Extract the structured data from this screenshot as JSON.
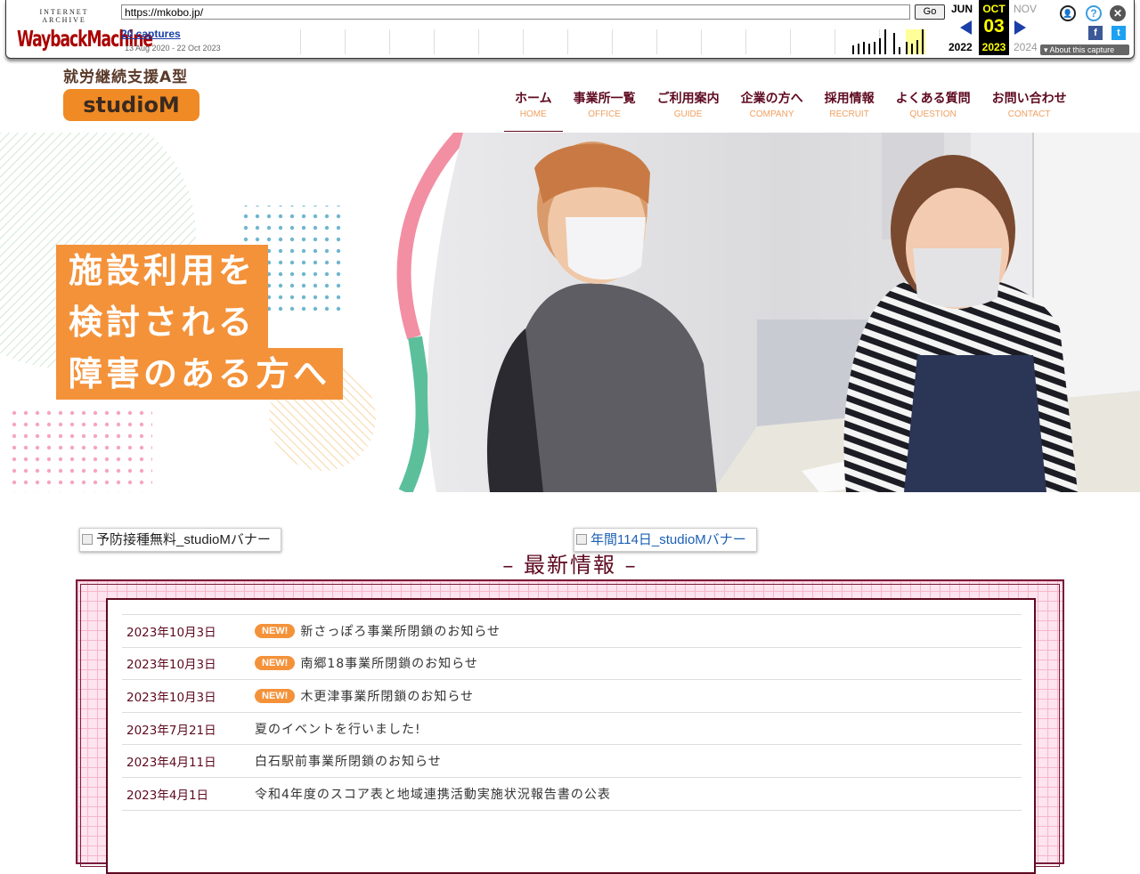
{
  "wayback": {
    "logo_top": "INTERNET ARCHIVE",
    "logo_main": "WaybackMachine",
    "url": "https://mkobo.jp/",
    "go_label": "Go",
    "captures_label": "20 captures",
    "date_range": "13 Aug 2020 - 22 Oct 2023",
    "prev_month": "JUN",
    "prev_year": "2022",
    "current_month": "OCT",
    "current_day": "03",
    "current_year": "2023",
    "next_month": "NOV",
    "next_year": "2024",
    "about_label": "About this capture",
    "facebook_glyph": "f",
    "twitter_glyph": "t",
    "help_glyph": "?",
    "close_glyph": "✕",
    "user_glyph": "👤"
  },
  "site": {
    "tagline": "就労継続支援A型",
    "brand": "studioM",
    "brand_color": "#f08a24",
    "accent_color": "#5e0a20"
  },
  "nav": {
    "items": [
      {
        "jp": "ホーム",
        "en": "HOME"
      },
      {
        "jp": "事業所一覧",
        "en": "OFFICE"
      },
      {
        "jp": "ご利用案内",
        "en": "GUIDE"
      },
      {
        "jp": "企業の方へ",
        "en": "COMPANY"
      },
      {
        "jp": "採用情報",
        "en": "RECRUIT"
      },
      {
        "jp": "よくある質問",
        "en": "QUESTION"
      },
      {
        "jp": "お問い合わせ",
        "en": "CONTACT"
      }
    ]
  },
  "hero": {
    "line1": "施設利用を",
    "line2": "検討される",
    "line3": "障害のある方へ"
  },
  "banners": {
    "left_alt": "予防接種無料_studioMバナー",
    "right_alt": "年間114日_studioMバナー"
  },
  "news": {
    "heading": "– 最新情報 –",
    "new_badge": "NEW!",
    "items": [
      {
        "date": "2023年10月3日",
        "title": "新さっぽろ事業所閉鎖のお知らせ",
        "is_new": true
      },
      {
        "date": "2023年10月3日",
        "title": "南郷18事業所閉鎖のお知らせ",
        "is_new": true
      },
      {
        "date": "2023年10月3日",
        "title": "木更津事業所閉鎖のお知らせ",
        "is_new": true
      },
      {
        "date": "2023年7月21日",
        "title": "夏のイベントを行いました!",
        "is_new": false
      },
      {
        "date": "2023年4月11日",
        "title": "白石駅前事業所閉鎖のお知らせ",
        "is_new": false
      },
      {
        "date": "2023年4月1日",
        "title": "令和4年度のスコア表と地域連携活動実施状況報告書の公表",
        "is_new": false
      }
    ]
  }
}
